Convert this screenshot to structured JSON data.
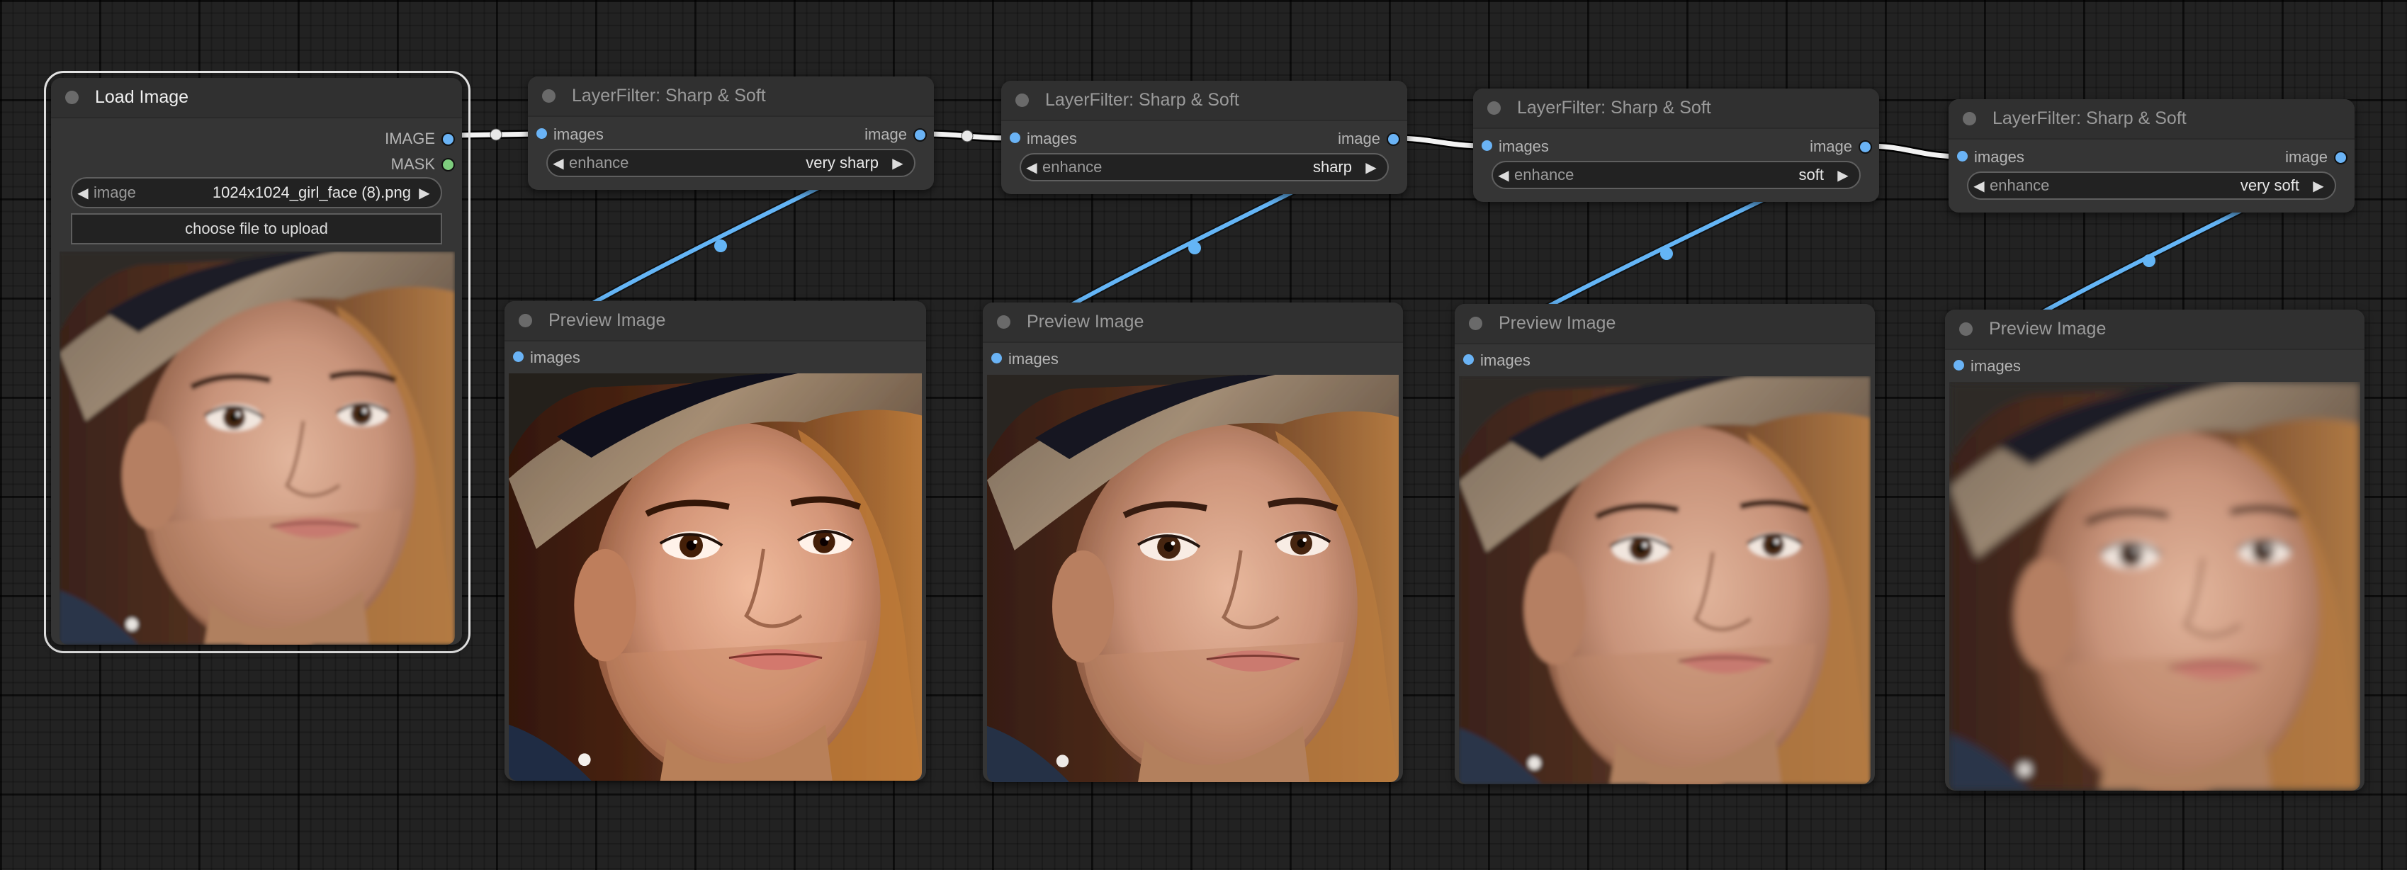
{
  "app": "ComfyUI node graph",
  "colors": {
    "canvas_bg": "#222222",
    "node_bg": "#353535",
    "image_slot": "#6ab3f5",
    "mask_slot": "#7dcc7d",
    "link_image": "#64b5f6",
    "link_selected": "#ffffff"
  },
  "load_image": {
    "title": "Load Image",
    "outputs": [
      {
        "label": "IMAGE",
        "type": "image"
      },
      {
        "label": "MASK",
        "type": "mask"
      }
    ],
    "image_widget": {
      "name": "image",
      "value": "1024x1024_girl_face (8).png"
    },
    "upload_label": "choose file to upload",
    "preview": "original"
  },
  "filters": [
    {
      "title": "LayerFilter: Sharp & Soft",
      "input_label": "images",
      "output_label": "image",
      "widget_name": "enhance",
      "widget_value": "very sharp"
    },
    {
      "title": "LayerFilter: Sharp & Soft",
      "input_label": "images",
      "output_label": "image",
      "widget_name": "enhance",
      "widget_value": "sharp"
    },
    {
      "title": "LayerFilter: Sharp & Soft",
      "input_label": "images",
      "output_label": "image",
      "widget_name": "enhance",
      "widget_value": "soft"
    },
    {
      "title": "LayerFilter: Sharp & Soft",
      "input_label": "images",
      "output_label": "image",
      "widget_name": "enhance",
      "widget_value": "very soft"
    }
  ],
  "previews": [
    {
      "title": "Preview Image",
      "input_label": "images",
      "variant": "very sharp"
    },
    {
      "title": "Preview Image",
      "input_label": "images",
      "variant": "sharp"
    },
    {
      "title": "Preview Image",
      "input_label": "images",
      "variant": "soft"
    },
    {
      "title": "Preview Image",
      "input_label": "images",
      "variant": "very soft"
    }
  ],
  "icons": {
    "arrow_left": "◀",
    "arrow_right": "▶"
  }
}
